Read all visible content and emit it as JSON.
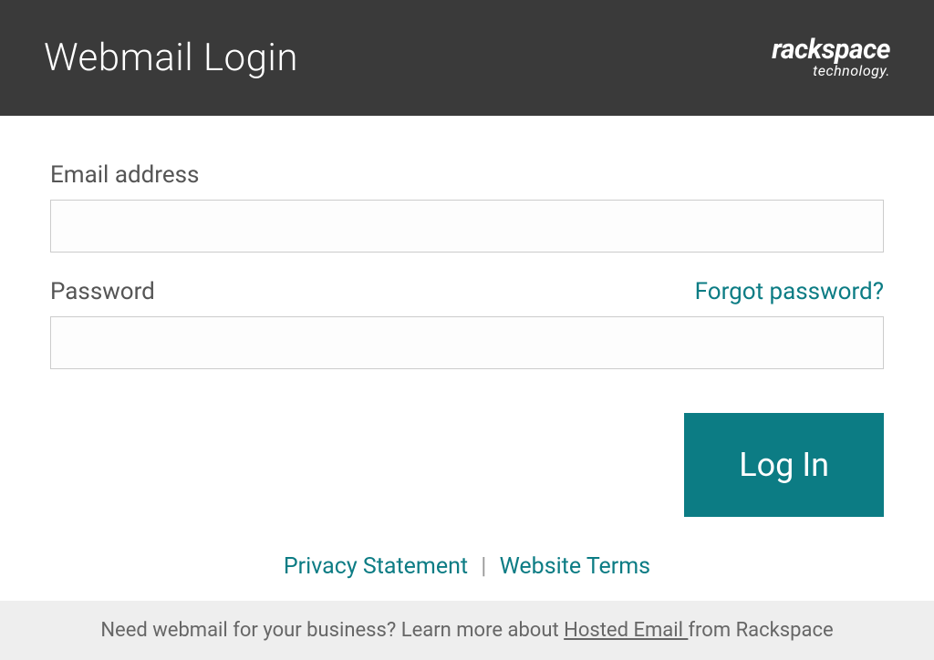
{
  "header": {
    "title": "Webmail Login",
    "logo_main": "rackspace",
    "logo_sub": "technology."
  },
  "form": {
    "email_label": "Email address",
    "email_value": "",
    "password_label": "Password",
    "password_value": "",
    "forgot_link": "Forgot password?",
    "submit_label": "Log In"
  },
  "footer": {
    "privacy_link": "Privacy Statement",
    "separator": "|",
    "terms_link": "Website Terms"
  },
  "promo": {
    "prefix": "Need webmail for your business? Learn more about ",
    "link": "Hosted Email ",
    "suffix": "from Rackspace"
  },
  "colors": {
    "header_bg": "#3a3a3a",
    "accent": "#0c7c84",
    "text_muted": "#555555",
    "promo_bg": "#eeeeee"
  }
}
